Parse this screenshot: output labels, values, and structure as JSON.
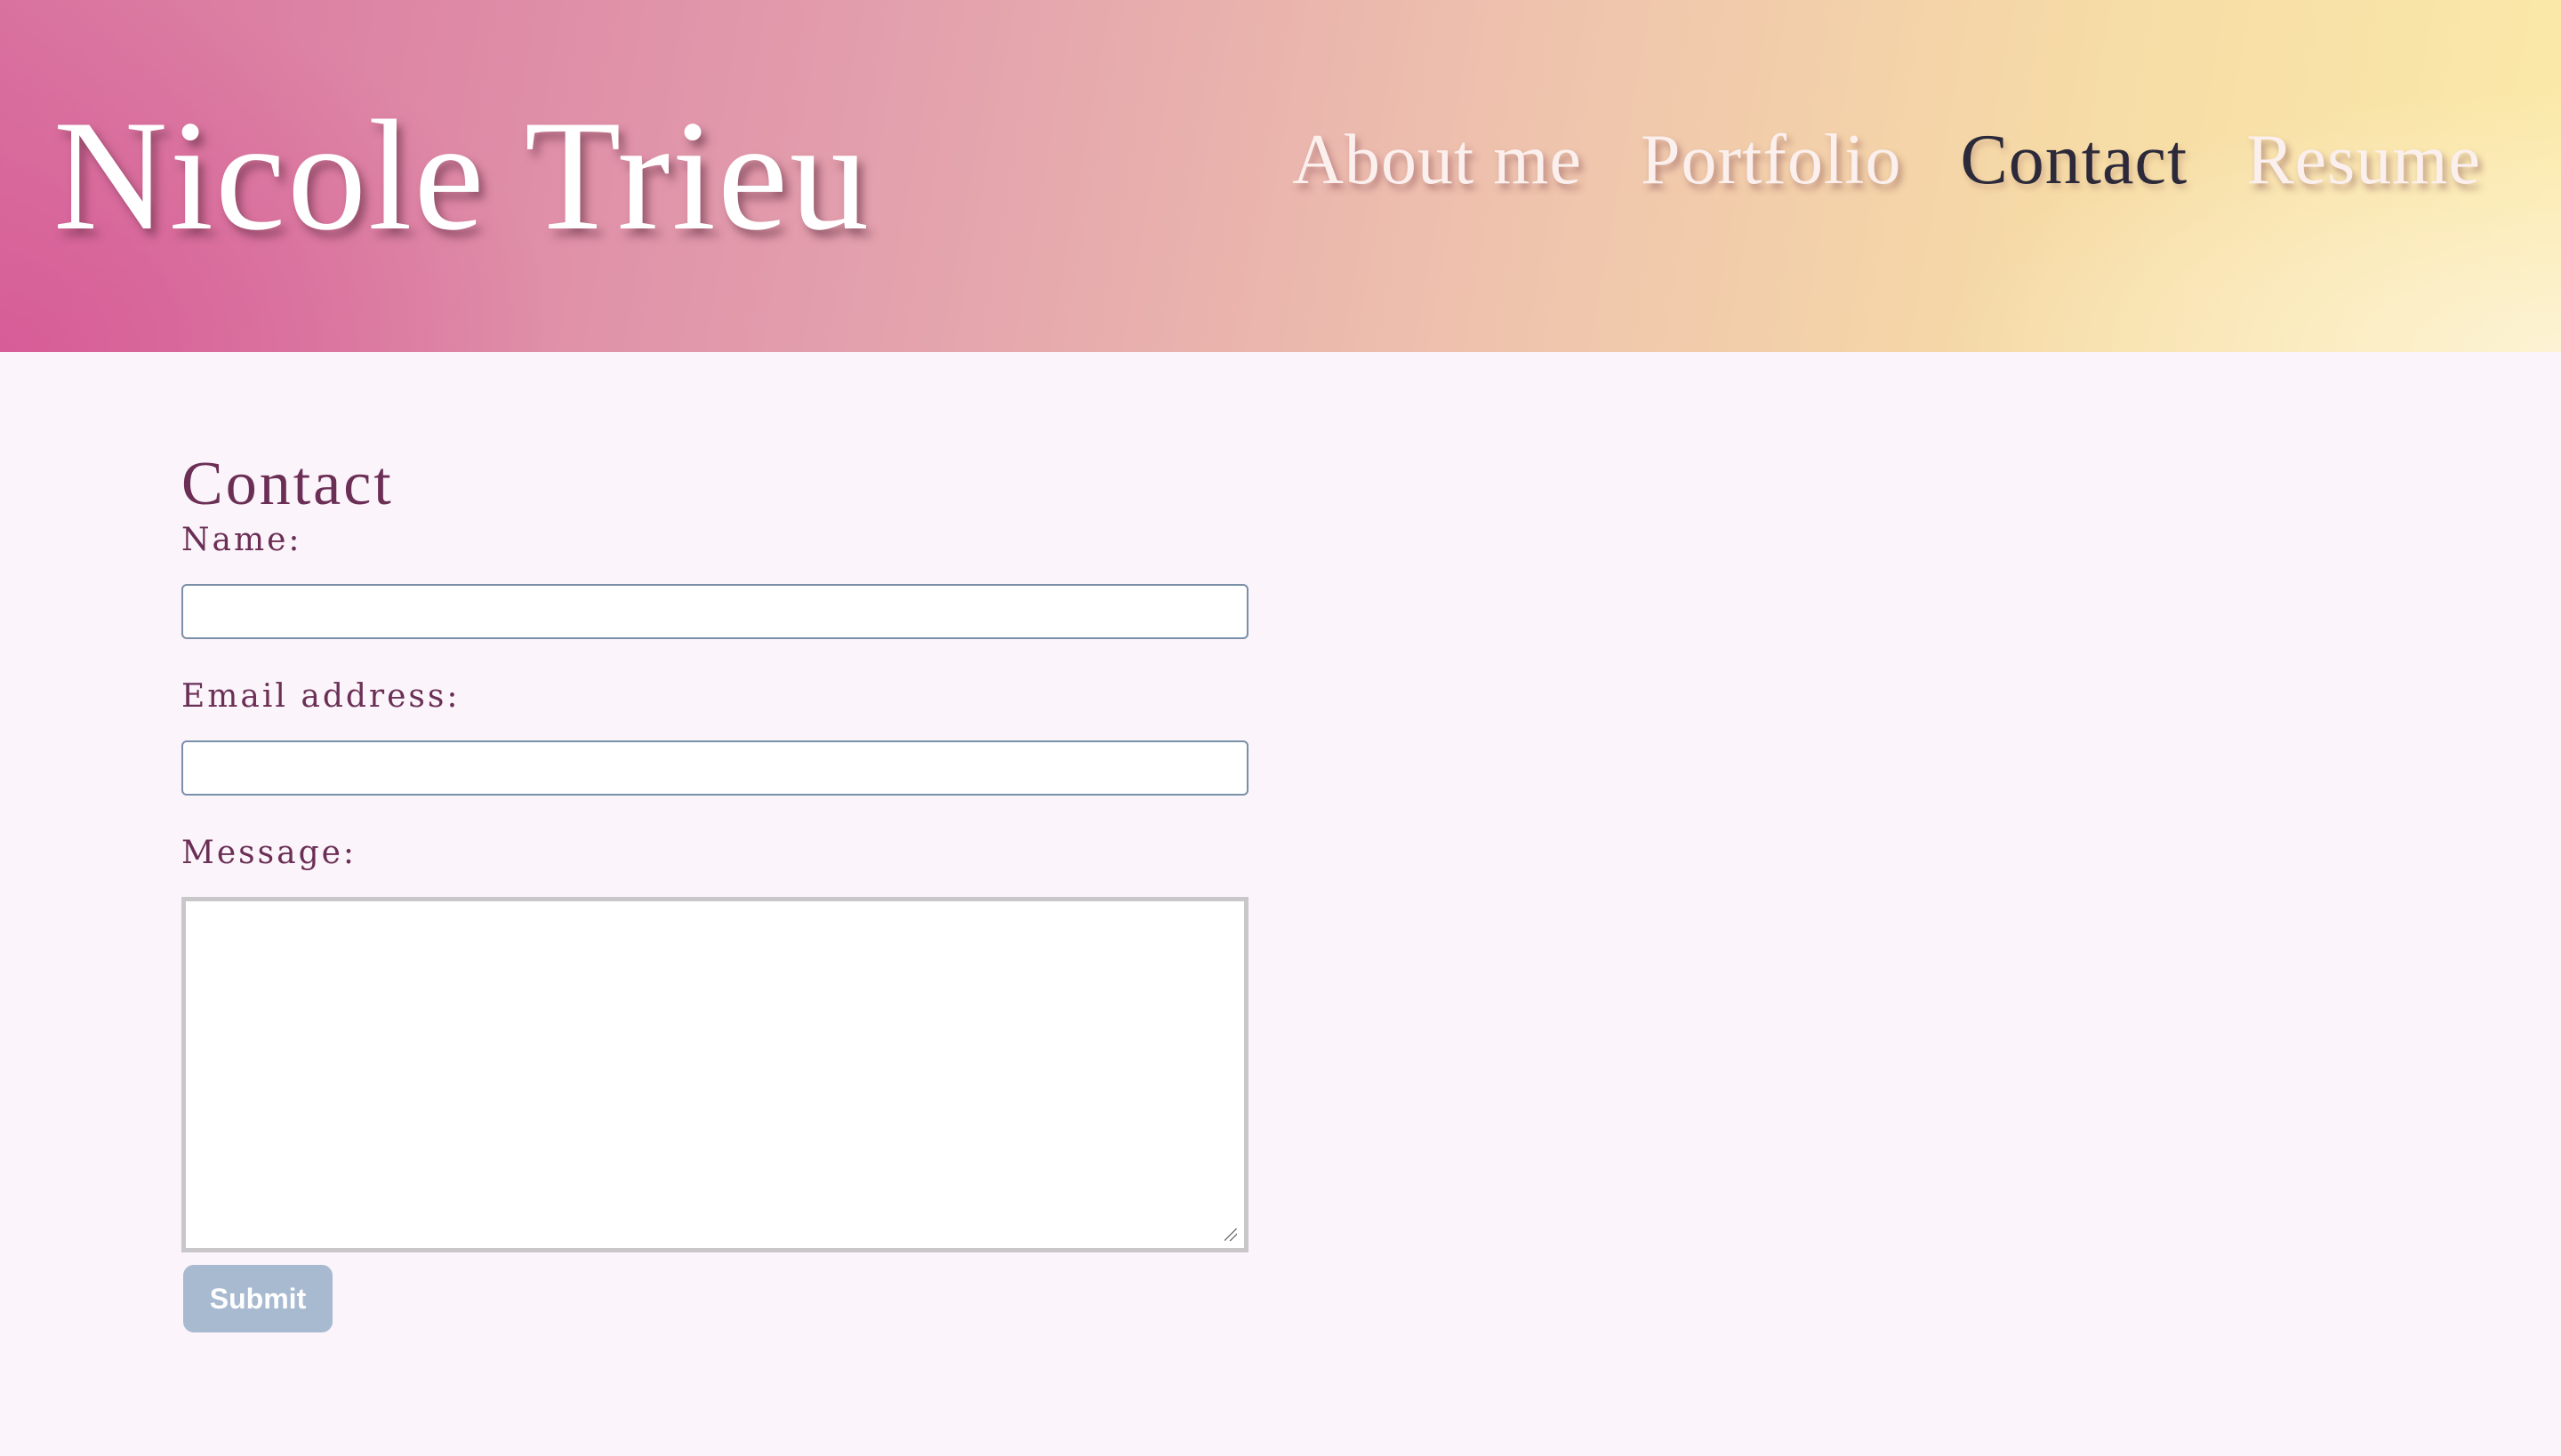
{
  "header": {
    "site_title": "Nicole Trieu",
    "nav": [
      {
        "label": "About me",
        "active": false
      },
      {
        "label": "Portfolio",
        "active": false
      },
      {
        "label": "Contact",
        "active": true
      },
      {
        "label": "Resume",
        "active": false
      }
    ]
  },
  "form": {
    "heading": "Contact",
    "name_label": "Name:",
    "name_value": "",
    "email_label": "Email address:",
    "email_value": "",
    "message_label": "Message:",
    "message_value": "",
    "submit_label": "Submit"
  },
  "colors": {
    "heading": "#6b2f55",
    "active_nav": "#2c2a3a",
    "button": "#a8bacf",
    "page_background": "#fbf4fa"
  }
}
